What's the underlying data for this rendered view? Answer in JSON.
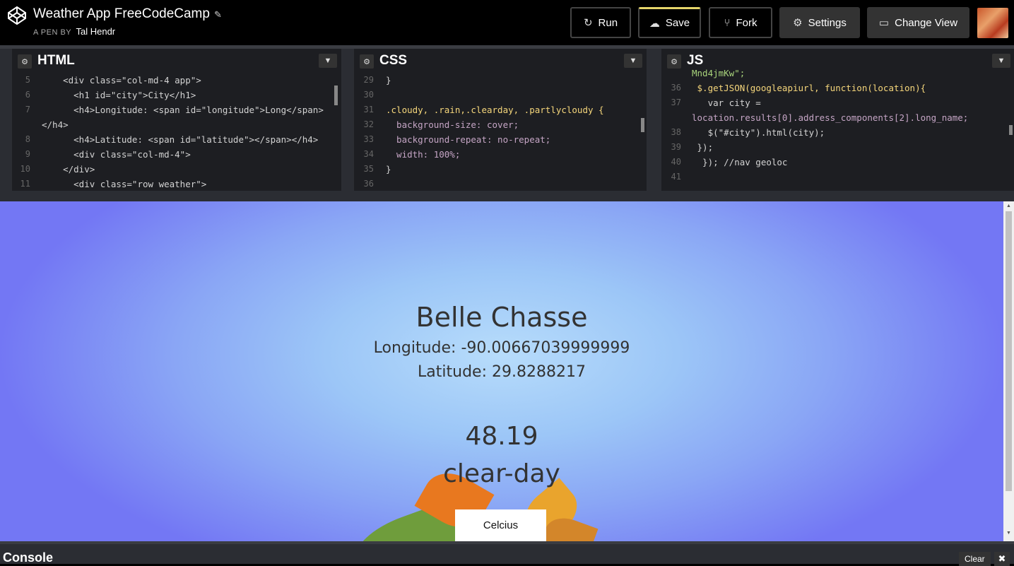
{
  "header": {
    "title": "Weather App FreeCodeCamp",
    "by_label": "A PEN BY",
    "author": "Tal Hendr",
    "buttons": {
      "run": "Run",
      "save": "Save",
      "fork": "Fork",
      "settings": "Settings",
      "change_view": "Change View"
    },
    "icons": {
      "logo": "codepen-logo-icon",
      "edit": "pencil-icon",
      "run": "refresh-icon",
      "save": "cloud-icon",
      "fork": "fork-icon",
      "settings": "gear-icon",
      "change_view": "layout-icon"
    }
  },
  "editors": {
    "html": {
      "name": "HTML",
      "lines": [
        {
          "n": "5",
          "text": "    <div class=\"col-md-4 app\">"
        },
        {
          "n": "6",
          "text": "      <h1 id=\"city\">City</h1>"
        },
        {
          "n": "7",
          "text": "      <h4>Longitude: <span id=\"longitude\">Long</span>"
        },
        {
          "n": "",
          "text": "</h4>"
        },
        {
          "n": "8",
          "text": "      <h4>Latitude: <span id=\"latitude\"></span></h4>"
        },
        {
          "n": "9",
          "text": "      <div class=\"col-md-4\">"
        },
        {
          "n": "10",
          "text": "    </div>"
        },
        {
          "n": "11",
          "text": "      <div class=\"row weather\">"
        }
      ]
    },
    "css": {
      "name": "CSS",
      "lines": [
        {
          "n": "29",
          "text": "}"
        },
        {
          "n": "30",
          "text": ""
        },
        {
          "n": "31",
          "text": ".cloudy, .rain,.clearday, .partlycloudy {"
        },
        {
          "n": "32",
          "text": "  background-size: cover;"
        },
        {
          "n": "33",
          "text": "  background-repeat: no-repeat;"
        },
        {
          "n": "34",
          "text": "  width: 100%;"
        },
        {
          "n": "35",
          "text": "}"
        },
        {
          "n": "36",
          "text": ""
        }
      ]
    },
    "js": {
      "name": "JS",
      "lines": [
        {
          "n": "",
          "text": "Mnd4jmKw\";"
        },
        {
          "n": "36",
          "text": " $.getJSON(googleapiurl, function(location){"
        },
        {
          "n": "37",
          "text": "   var city ="
        },
        {
          "n": "",
          "text": "location.results[0].address_components[2].long_name;"
        },
        {
          "n": "38",
          "text": "   $(\"#city\").html(city);"
        },
        {
          "n": "39",
          "text": " });"
        },
        {
          "n": "40",
          "text": "  }); //nav geoloc"
        },
        {
          "n": "41",
          "text": ""
        }
      ]
    }
  },
  "preview": {
    "city": "Belle Chasse",
    "longitude": "Longitude: -90.00667039999999",
    "latitude": "Latitude: 29.8288217",
    "temperature": "48.19",
    "condition": "clear-day",
    "unit_button": "Celcius"
  },
  "console": {
    "title": "Console",
    "clear": "Clear",
    "close": "✖"
  }
}
